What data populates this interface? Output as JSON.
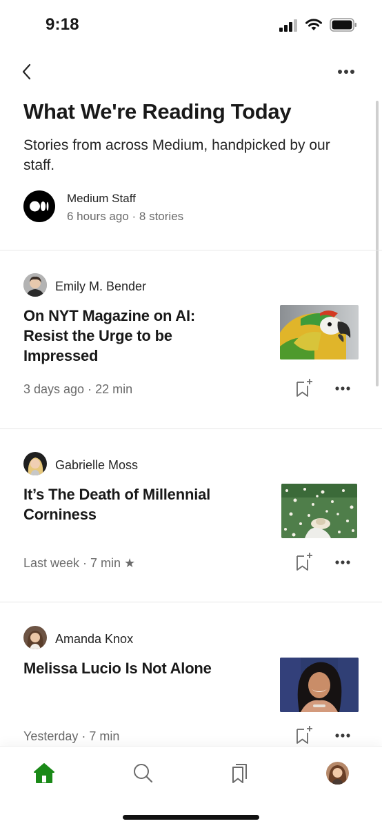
{
  "status_bar": {
    "time": "9:18"
  },
  "header": {
    "title": "What We're Reading Today",
    "subtitle": "Stories from across Medium, handpicked by our staff.",
    "publisher": "Medium Staff",
    "meta": "6 hours ago · 8 stories"
  },
  "stories": [
    {
      "author": "Emily M. Bender",
      "title": "On NYT Magazine on AI: Resist the Urge to be Impressed",
      "meta": "3 days ago · 22 min"
    },
    {
      "author": "Gabrielle Moss",
      "title": "It’s The Death of Millennial Corniness",
      "meta": "Last week · 7 min ★"
    },
    {
      "author": "Amanda Knox",
      "title": "Melissa Lucio Is Not Alone",
      "meta": "Yesterday · 7 min"
    }
  ],
  "tabs": [
    {
      "icon": "home-icon",
      "active": true
    },
    {
      "icon": "search-icon",
      "active": false
    },
    {
      "icon": "bookmarks-icon",
      "active": false
    },
    {
      "icon": "profile-avatar",
      "active": false
    }
  ],
  "colors": {
    "accent": "#1a8917",
    "text": "#191919",
    "muted": "#6b6b6b"
  }
}
